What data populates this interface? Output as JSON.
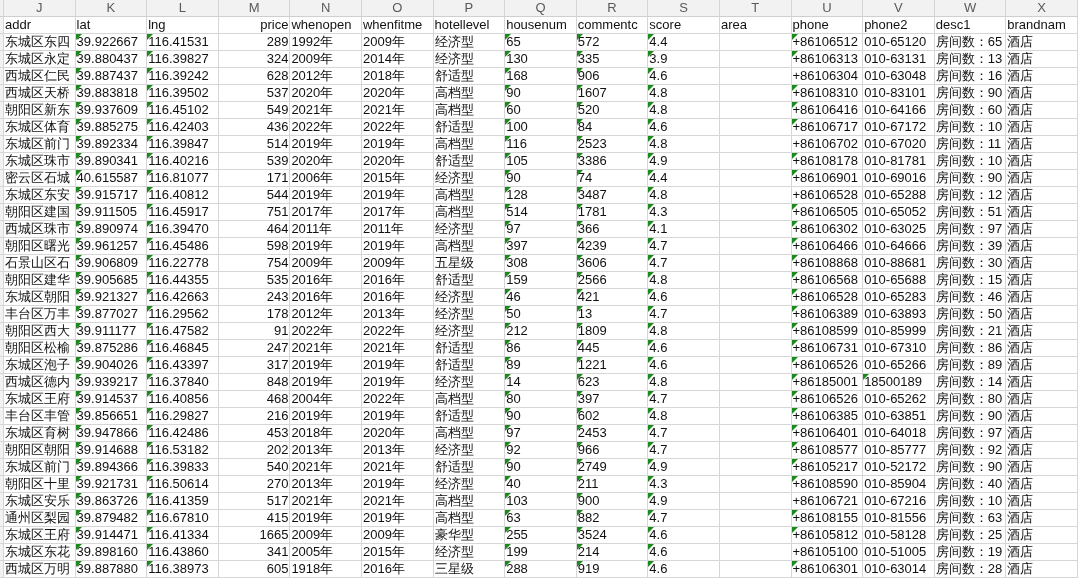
{
  "column_letters": [
    "J",
    "K",
    "L",
    "M",
    "N",
    "O",
    "P",
    "Q",
    "R",
    "S",
    "T",
    "U",
    "V",
    "W",
    "X"
  ],
  "columns": [
    {
      "name": "addr",
      "kind": "text",
      "flagged": false
    },
    {
      "name": "lat",
      "kind": "text",
      "flagged": true
    },
    {
      "name": "lng",
      "kind": "text",
      "flagged": true
    },
    {
      "name": "price",
      "kind": "number",
      "flagged": false
    },
    {
      "name": "whenopen",
      "kind": "text",
      "flagged": false
    },
    {
      "name": "whenfitme",
      "kind": "text",
      "flagged": false
    },
    {
      "name": "hotellevel",
      "kind": "text",
      "flagged": false
    },
    {
      "name": "housenum",
      "kind": "text",
      "flagged": true
    },
    {
      "name": "commentc",
      "kind": "text",
      "flagged": true
    },
    {
      "name": "score",
      "kind": "text",
      "flagged": true
    },
    {
      "name": "area",
      "kind": "text",
      "flagged": false
    },
    {
      "name": "phone",
      "kind": "phone",
      "flagged": false
    },
    {
      "name": "phone2",
      "kind": "phone2",
      "flagged": false
    },
    {
      "name": "desc1",
      "kind": "text",
      "flagged": false
    },
    {
      "name": "brandnam",
      "kind": "text",
      "flagged": false
    }
  ],
  "rows": [
    {
      "cells": [
        "东城区东四",
        "39.922667",
        "116.41531",
        "289",
        "1992年",
        "2009年",
        "经济型",
        "65",
        "572",
        "4.4",
        "",
        "+86106512",
        "010-65120",
        "房间数：65",
        "酒店"
      ],
      "flagged_phone": true,
      "flagged_phone2": false
    },
    {
      "cells": [
        "东城区永定",
        "39.880437",
        "116.39827",
        "324",
        "2009年",
        "2014年",
        "经济型",
        "130",
        "335",
        "3.9",
        "",
        "+86106313",
        "010-63131",
        "房间数：13",
        "酒店"
      ],
      "flagged_phone": true,
      "flagged_phone2": false
    },
    {
      "cells": [
        "西城区仁民",
        "39.887437",
        "116.39242",
        "628",
        "2012年",
        "2018年",
        "舒适型",
        "168",
        "906",
        "4.6",
        "",
        "+86106304",
        "010-63048",
        "房间数：16",
        "酒店"
      ],
      "flagged_phone": false,
      "flagged_phone2": false
    },
    {
      "cells": [
        "西城区天桥",
        "39.883818",
        "116.39502",
        "537",
        "2020年",
        "2020年",
        "高档型",
        "90",
        "1607",
        "4.8",
        "",
        "+86108310",
        "010-83101",
        "房间数：90",
        "酒店"
      ],
      "flagged_phone": true,
      "flagged_phone2": false
    },
    {
      "cells": [
        "朝阳区新东",
        "39.937609",
        "116.45102",
        "549",
        "2021年",
        "2021年",
        "高档型",
        "60",
        "520",
        "4.8",
        "",
        "+86106416",
        "010-64166",
        "房间数：60",
        "酒店"
      ],
      "flagged_phone": true,
      "flagged_phone2": false
    },
    {
      "cells": [
        "东城区体育",
        "39.885275",
        "116.42403",
        "436",
        "2022年",
        "2022年",
        "舒适型",
        "100",
        "84",
        "4.6",
        "",
        "+86106717",
        "010-67172",
        "房间数：10",
        "酒店"
      ],
      "flagged_phone": true,
      "flagged_phone2": false
    },
    {
      "cells": [
        "东城区前门",
        "39.892334",
        "116.39847",
        "514",
        "2019年",
        "2019年",
        "高档型",
        "116",
        "2523",
        "4.8",
        "",
        "+86106702",
        "010-67020",
        "房间数：11",
        "酒店"
      ],
      "flagged_phone": false,
      "flagged_phone2": false
    },
    {
      "cells": [
        "东城区珠市",
        "39.890341",
        "116.40216",
        "539",
        "2020年",
        "2020年",
        "舒适型",
        "105",
        "3386",
        "4.9",
        "",
        "+86108178",
        "010-81781",
        "房间数：10",
        "酒店"
      ],
      "flagged_phone": true,
      "flagged_phone2": false
    },
    {
      "cells": [
        "密云区石城",
        "40.615587",
        "116.81077",
        "171",
        "2006年",
        "2015年",
        "经济型",
        "90",
        "74",
        "4.4",
        "",
        "+86106901",
        "010-69016",
        "房间数：90",
        "酒店"
      ],
      "flagged_phone": true,
      "flagged_phone2": false
    },
    {
      "cells": [
        "东城区东安",
        "39.915717",
        "116.40812",
        "544",
        "2019年",
        "2019年",
        "高档型",
        "128",
        "3487",
        "4.8",
        "",
        "+86106528",
        "010-65288",
        "房间数：12",
        "酒店"
      ],
      "flagged_phone": false,
      "flagged_phone2": false
    },
    {
      "cells": [
        "朝阳区建国",
        "39.911505",
        "116.45917",
        "751",
        "2017年",
        "2017年",
        "高档型",
        "514",
        "1781",
        "4.3",
        "",
        "+86106505",
        "010-65052",
        "房间数：51",
        "酒店"
      ],
      "flagged_phone": true,
      "flagged_phone2": false
    },
    {
      "cells": [
        "西城区珠市",
        "39.890974",
        "116.39470",
        "464",
        "2011年",
        "2011年",
        "经济型",
        "97",
        "366",
        "4.1",
        "",
        "+86106302",
        "010-63025",
        "房间数：97",
        "酒店"
      ],
      "flagged_phone": true,
      "flagged_phone2": false
    },
    {
      "cells": [
        "朝阳区曙光",
        "39.961257",
        "116.45486",
        "598",
        "2019年",
        "2019年",
        "高档型",
        "397",
        "4239",
        "4.7",
        "",
        "+86106466",
        "010-64666",
        "房间数：39",
        "酒店"
      ],
      "flagged_phone": true,
      "flagged_phone2": false
    },
    {
      "cells": [
        "石景山区石",
        "39.906809",
        "116.22778",
        "754",
        "2009年",
        "2009年",
        "五星级",
        "308",
        "3606",
        "4.7",
        "",
        "+86108868",
        "010-88681",
        "房间数：30",
        "酒店"
      ],
      "flagged_phone": true,
      "flagged_phone2": false
    },
    {
      "cells": [
        "朝阳区建华",
        "39.905685",
        "116.44355",
        "535",
        "2016年",
        "2016年",
        "舒适型",
        "159",
        "2566",
        "4.8",
        "",
        "+86106568",
        "010-65688",
        "房间数：15",
        "酒店"
      ],
      "flagged_phone": true,
      "flagged_phone2": false
    },
    {
      "cells": [
        "东城区朝阳",
        "39.921327",
        "116.42663",
        "243",
        "2016年",
        "2016年",
        "经济型",
        "46",
        "421",
        "4.6",
        "",
        "+86106528",
        "010-65283",
        "房间数：46",
        "酒店"
      ],
      "flagged_phone": true,
      "flagged_phone2": false
    },
    {
      "cells": [
        "丰台区万丰",
        "39.877027",
        "116.29562",
        "178",
        "2012年",
        "2013年",
        "经济型",
        "50",
        "13",
        "4.7",
        "",
        "+86106389",
        "010-63893",
        "房间数：50",
        "酒店"
      ],
      "flagged_phone": true,
      "flagged_phone2": false
    },
    {
      "cells": [
        "朝阳区西大",
        "39.911177",
        "116.47582",
        "91",
        "2022年",
        "2022年",
        "经济型",
        "212",
        "1809",
        "4.8",
        "",
        "+86108599",
        "010-85999",
        "房间数：21",
        "酒店"
      ],
      "flagged_phone": true,
      "flagged_phone2": false
    },
    {
      "cells": [
        "朝阳区松榆",
        "39.875286",
        "116.46845",
        "247",
        "2021年",
        "2021年",
        "舒适型",
        "86",
        "445",
        "4.6",
        "",
        "+86106731",
        "010-67310",
        "房间数：86",
        "酒店"
      ],
      "flagged_phone": true,
      "flagged_phone2": false
    },
    {
      "cells": [
        "东城区泡子",
        "39.904026",
        "116.43397",
        "317",
        "2019年",
        "2019年",
        "舒适型",
        "89",
        "1221",
        "4.6",
        "",
        "+86106526",
        "010-65266",
        "房间数：89",
        "酒店"
      ],
      "flagged_phone": true,
      "flagged_phone2": false
    },
    {
      "cells": [
        "西城区德内",
        "39.939217",
        "116.37840",
        "848",
        "2019年",
        "2019年",
        "经济型",
        "14",
        "623",
        "4.8",
        "",
        "+86185001",
        "18500189",
        "房间数：14",
        "酒店"
      ],
      "flagged_phone": true,
      "flagged_phone2": true
    },
    {
      "cells": [
        "东城区王府",
        "39.914537",
        "116.40856",
        "468",
        "2004年",
        "2022年",
        "高档型",
        "80",
        "397",
        "4.7",
        "",
        "+86106526",
        "010-65262",
        "房间数：80",
        "酒店"
      ],
      "flagged_phone": true,
      "flagged_phone2": false
    },
    {
      "cells": [
        "丰台区丰管",
        "39.856651",
        "116.29827",
        "216",
        "2019年",
        "2019年",
        "舒适型",
        "90",
        "602",
        "4.8",
        "",
        "+86106385",
        "010-63851",
        "房间数：90",
        "酒店"
      ],
      "flagged_phone": true,
      "flagged_phone2": false
    },
    {
      "cells": [
        "东城区育树",
        "39.947866",
        "116.42486",
        "453",
        "2018年",
        "2020年",
        "高档型",
        "97",
        "2453",
        "4.7",
        "",
        "+86106401",
        "010-64018",
        "房间数：97",
        "酒店"
      ],
      "flagged_phone": true,
      "flagged_phone2": false
    },
    {
      "cells": [
        "朝阳区朝阳",
        "39.914688",
        "116.53182",
        "202",
        "2013年",
        "2013年",
        "经济型",
        "92",
        "966",
        "4.7",
        "",
        "+86108577",
        "010-85777",
        "房间数：92",
        "酒店"
      ],
      "flagged_phone": true,
      "flagged_phone2": false
    },
    {
      "cells": [
        "东城区前门",
        "39.894366",
        "116.39833",
        "540",
        "2021年",
        "2021年",
        "舒适型",
        "90",
        "2749",
        "4.9",
        "",
        "+86105217",
        "010-52172",
        "房间数：90",
        "酒店"
      ],
      "flagged_phone": true,
      "flagged_phone2": false
    },
    {
      "cells": [
        "朝阳区十里",
        "39.921731",
        "116.50614",
        "270",
        "2013年",
        "2019年",
        "经济型",
        "40",
        "211",
        "4.3",
        "",
        "+86108590",
        "010-85904",
        "房间数：40",
        "酒店"
      ],
      "flagged_phone": true,
      "flagged_phone2": false
    },
    {
      "cells": [
        "东城区安乐",
        "39.863726",
        "116.41359",
        "517",
        "2021年",
        "2021年",
        "高档型",
        "103",
        "900",
        "4.9",
        "",
        "+86106721",
        "010-67216",
        "房间数：10",
        "酒店"
      ],
      "flagged_phone": false,
      "flagged_phone2": false
    },
    {
      "cells": [
        "通州区梨园",
        "39.879482",
        "116.67810",
        "415",
        "2019年",
        "2019年",
        "高档型",
        "63",
        "882",
        "4.7",
        "",
        "+86108155",
        "010-81556",
        "房间数：63",
        "酒店"
      ],
      "flagged_phone": true,
      "flagged_phone2": false
    },
    {
      "cells": [
        "东城区王府",
        "39.914471",
        "116.41334",
        "1665",
        "2009年",
        "2009年",
        "豪华型",
        "255",
        "3524",
        "4.6",
        "",
        "+86105812",
        "010-58128",
        "房间数：25",
        "酒店"
      ],
      "flagged_phone": true,
      "flagged_phone2": false
    },
    {
      "cells": [
        "东城区东花",
        "39.898160",
        "116.43860",
        "341",
        "2005年",
        "2015年",
        "经济型",
        "199",
        "214",
        "4.6",
        "",
        "+86105100",
        "010-51005",
        "房间数：19",
        "酒店"
      ],
      "flagged_phone": false,
      "flagged_phone2": false
    },
    {
      "cells": [
        "西城区万明",
        "39.887880",
        "116.38973",
        "605",
        "1918年",
        "2016年",
        "三星级",
        "288",
        "919",
        "4.6",
        "",
        "+86106301",
        "010-63014",
        "房间数：28",
        "酒店"
      ],
      "flagged_phone": true,
      "flagged_phone2": false
    }
  ]
}
